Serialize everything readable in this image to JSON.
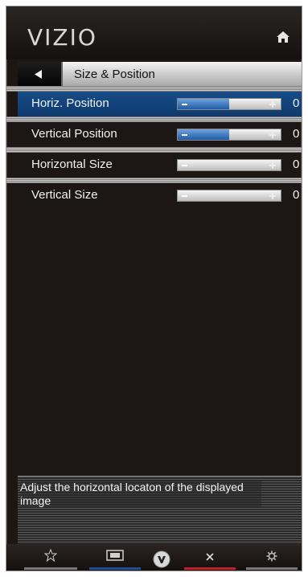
{
  "header": {
    "logo_text": "VIZIO",
    "home_icon": "home-icon"
  },
  "menu": {
    "back_icon": "left-arrow-icon",
    "title": "Size & Position"
  },
  "rows": [
    {
      "label": "Horiz. Position",
      "value": "0",
      "selected": true,
      "level": 0.5
    },
    {
      "label": "Vertical Position",
      "value": "0",
      "selected": false,
      "level": 0.5
    },
    {
      "label": "Horizontal Size",
      "value": "0",
      "selected": false,
      "level": 0
    },
    {
      "label": "Vertical Size",
      "value": "0",
      "selected": false,
      "level": 0
    }
  ],
  "help_text": "Adjust the horizontal locaton of  the displayed image",
  "footer": {
    "buttons": [
      {
        "icon": "star-icon",
        "color": "#7a7a7a"
      },
      {
        "icon": "widescreen-icon",
        "color": "#1f4e9a"
      },
      {
        "icon": "vizio-v-icon",
        "color": "#000000"
      },
      {
        "icon": "close-icon",
        "color": "#c0202a"
      },
      {
        "icon": "gear-icon",
        "color": "#7a7a7a"
      }
    ]
  },
  "colors": {
    "selected_row": "#174c86",
    "slider_fill": "#1f5ba6"
  }
}
